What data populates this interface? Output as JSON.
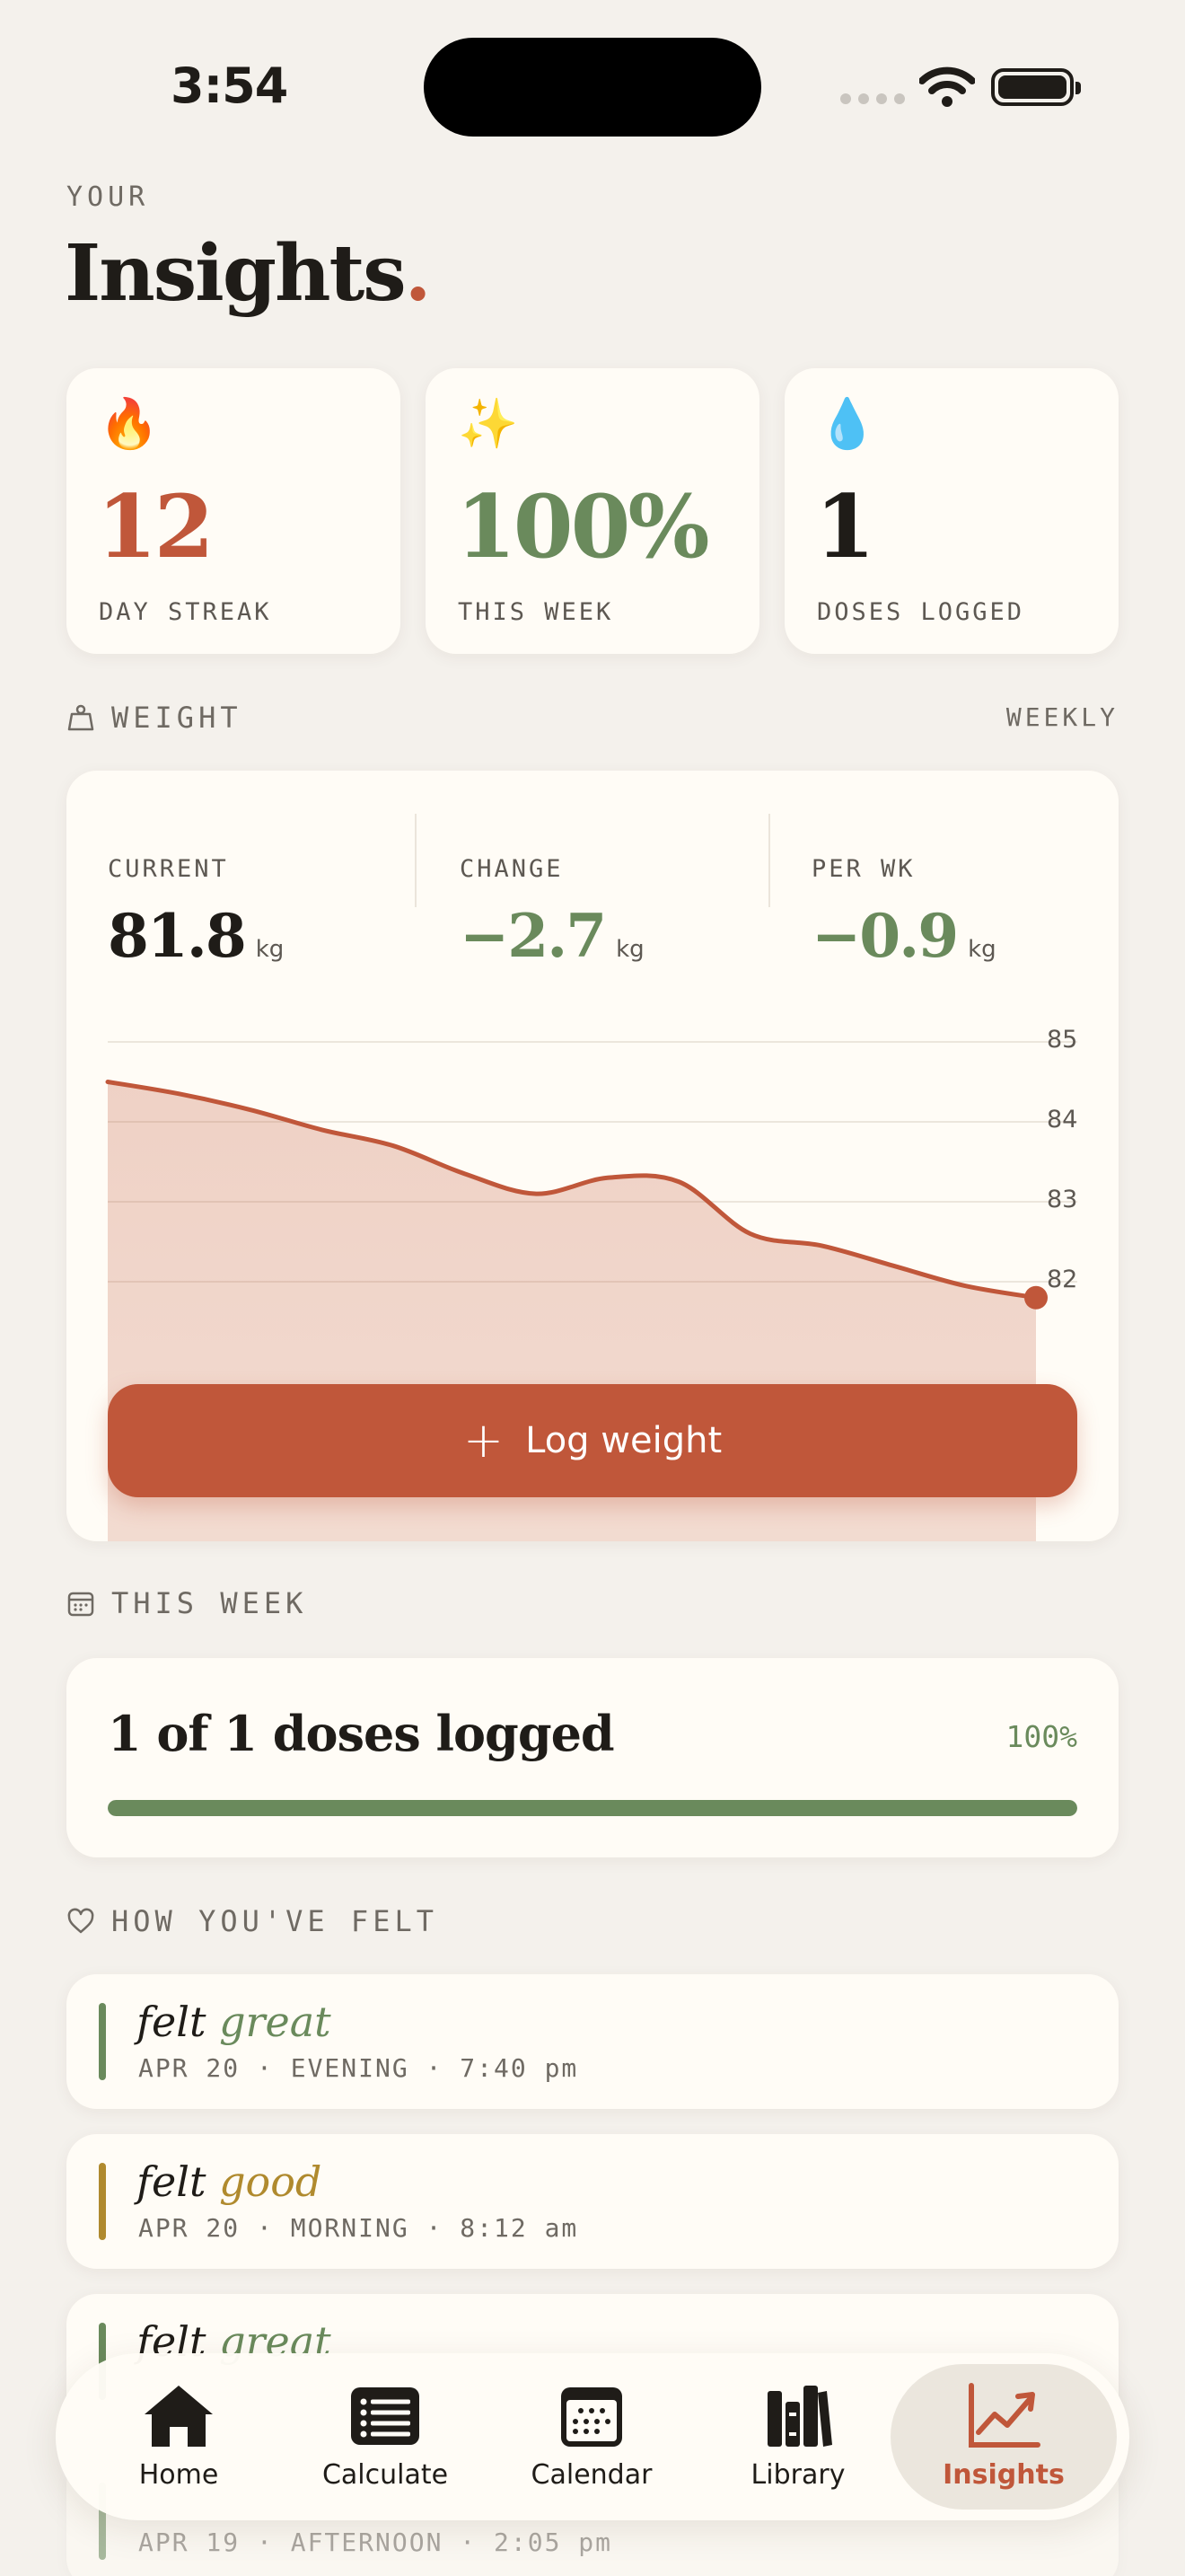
{
  "status": {
    "time": "3:54"
  },
  "header": {
    "eyebrow": "YOUR",
    "title": "Insights",
    "title_dot": "."
  },
  "stats": [
    {
      "emoji": "🔥",
      "icon": "fire-icon",
      "value": "12",
      "label": "DAY STREAK",
      "color": "#c0573a"
    },
    {
      "emoji": "✨",
      "icon": "sparkles-icon",
      "value": "100%",
      "label": "THIS WEEK",
      "color": "#6a8a5c"
    },
    {
      "emoji": "💧",
      "icon": "droplet-icon",
      "value": "1",
      "label": "DOSES LOGGED",
      "color": "#1f1c18"
    }
  ],
  "weight": {
    "section_label": "WEIGHT",
    "period": "WEEKLY",
    "metrics": [
      {
        "label": "CURRENT",
        "value": "81.8",
        "unit": "kg",
        "color": "#1f1c18"
      },
      {
        "label": "CHANGE",
        "value": "−2.7",
        "unit": "kg",
        "color": "#6a8a5c"
      },
      {
        "label": "PER WK",
        "value": "−0.9",
        "unit": "kg",
        "color": "#6a8a5c"
      }
    ],
    "log_button": "Log weight"
  },
  "chart_data": {
    "type": "area",
    "title": "",
    "xlabel": "",
    "ylabel": "",
    "ylim": [
      81.2,
      85
    ],
    "yticks": [
      85,
      84,
      83,
      82
    ],
    "grid": true,
    "series": [
      {
        "values": [
          84.5,
          84.35,
          84.15,
          83.9,
          83.7,
          83.35,
          83.1,
          83.3,
          83.25,
          82.6,
          82.45,
          82.2,
          81.95,
          81.8
        ]
      }
    ],
    "color": "#c0573a"
  },
  "week": {
    "section_label": "THIS WEEK",
    "title": "1 of 1 doses logged",
    "percent_text": "100%",
    "progress": 1.0
  },
  "feelings": {
    "section_label": "HOW YOU'VE FELT",
    "items": [
      {
        "prefix": "felt",
        "mood": "great",
        "color": "#6a8a5c",
        "meta": "APR 20 · EVENING · 7:40 pm"
      },
      {
        "prefix": "felt",
        "mood": "good",
        "color": "#b08a2e",
        "meta": "APR 20 · MORNING · 8:12 am"
      },
      {
        "prefix": "felt",
        "mood": "great",
        "color": "#6a8a5c",
        "meta": ""
      },
      {
        "prefix": "",
        "mood": "",
        "color": "#6a8a5c",
        "meta": "APR 19 · AFTERNOON · 2:05 pm"
      }
    ]
  },
  "tabs": [
    {
      "label": "Home",
      "icon": "home-icon"
    },
    {
      "label": "Calculate",
      "icon": "list-icon"
    },
    {
      "label": "Calendar",
      "icon": "calendar-icon"
    },
    {
      "label": "Library",
      "icon": "books-icon"
    },
    {
      "label": "Insights",
      "icon": "chart-icon",
      "active": true
    }
  ]
}
